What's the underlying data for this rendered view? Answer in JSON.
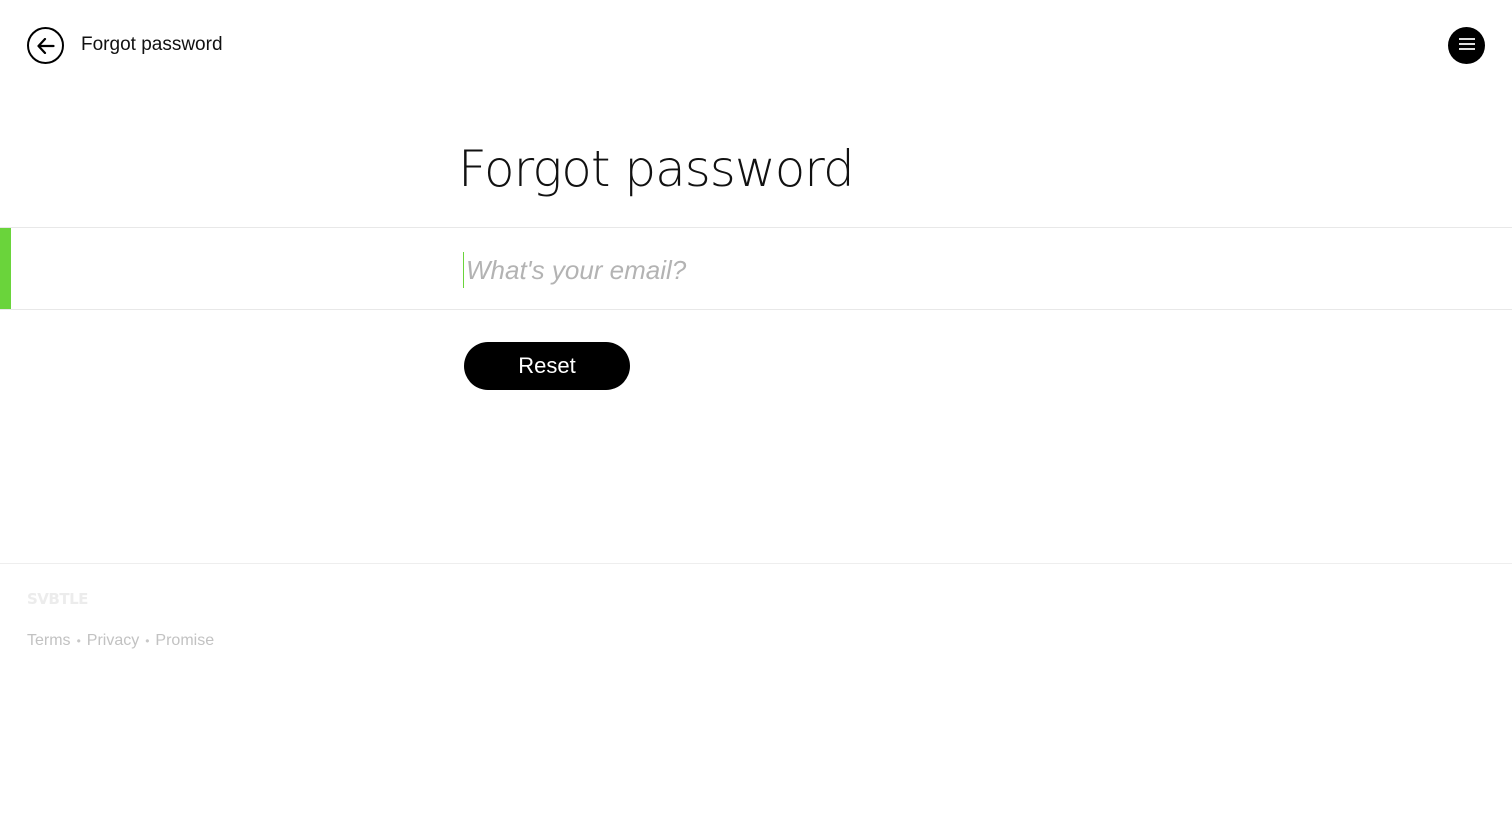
{
  "header": {
    "title": "Forgot password",
    "back_icon": "arrow-left-icon",
    "menu_icon": "hamburger-menu-icon"
  },
  "main": {
    "heading": "Forgot password",
    "email_input": {
      "placeholder": "What's your email?",
      "value": ""
    },
    "reset_label": "Reset"
  },
  "footer": {
    "logo": "SVBTLE",
    "links": [
      "Terms",
      "Privacy",
      "Promise"
    ],
    "separator": "•"
  },
  "colors": {
    "accent": "#6ad43b",
    "button": "#000000",
    "footer_text": "#c2c2c2"
  }
}
